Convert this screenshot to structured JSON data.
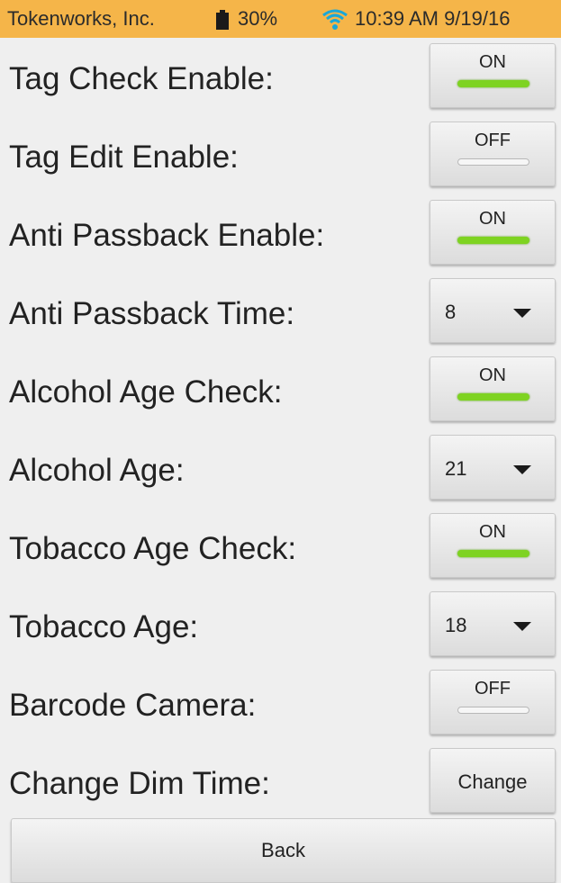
{
  "status_bar": {
    "carrier": "Tokenworks, Inc.",
    "battery_percent": "30%",
    "clock": "10:39 AM 9/19/16",
    "icons": [
      "battery-icon",
      "wifi-icon"
    ],
    "background_color": "#f5b549"
  },
  "settings": [
    {
      "label": "Tag Check Enable:",
      "control": "toggle",
      "state": "ON"
    },
    {
      "label": "Tag Edit Enable:",
      "control": "toggle",
      "state": "OFF"
    },
    {
      "label": "Anti Passback Enable:",
      "control": "toggle",
      "state": "ON"
    },
    {
      "label": "Anti Passback Time:",
      "control": "spinner",
      "value": "8"
    },
    {
      "label": "Alcohol Age Check:",
      "control": "toggle",
      "state": "ON"
    },
    {
      "label": "Alcohol Age:",
      "control": "spinner",
      "value": "21"
    },
    {
      "label": "Tobacco Age Check:",
      "control": "toggle",
      "state": "ON"
    },
    {
      "label": "Tobacco Age:",
      "control": "spinner",
      "value": "18"
    },
    {
      "label": "Barcode Camera:",
      "control": "toggle",
      "state": "OFF"
    },
    {
      "label": "Change Dim Time:",
      "control": "button",
      "button_label": "Change"
    }
  ],
  "back_button": {
    "label": "Back"
  },
  "colors": {
    "toggle_on": "#7ed321",
    "background": "#efefef"
  }
}
